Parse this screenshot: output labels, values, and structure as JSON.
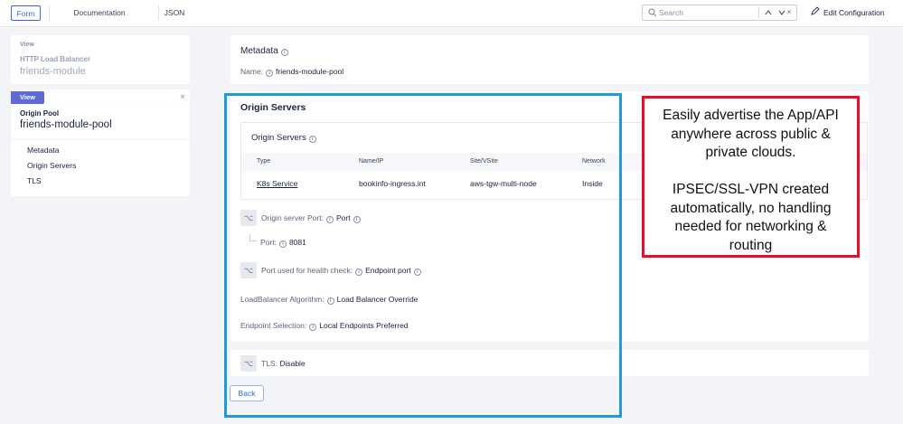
{
  "topbar": {
    "tabs": [
      "Form",
      "Documentation",
      "JSON"
    ],
    "active_tab": "Form",
    "search_placeholder": "Search",
    "search_prev": "^",
    "search_next": "v",
    "search_clear": "×",
    "edit_label": "Edit Configuration"
  },
  "sidebar": {
    "parent": {
      "view_label": "View",
      "type": "HTTP Load Balancer",
      "name": "friends-module"
    },
    "current": {
      "view_label": "View",
      "type": "Origin Pool",
      "name": "friends-module-pool",
      "close": "×"
    },
    "sections": [
      "Metadata",
      "Origin Servers",
      "TLS"
    ]
  },
  "metadata": {
    "title": "Metadata",
    "name_label": "Name:",
    "name_value": "friends-module-pool"
  },
  "origin": {
    "title": "Origin Servers",
    "table_title": "Origin Servers",
    "columns": [
      "Type",
      "Name/IP",
      "Site/VSite",
      "Network"
    ],
    "rows": [
      {
        "type": "K8s Service",
        "name": "bookinfo-ingress.int",
        "site": "aws-tgw-multi-node",
        "network": "Inside"
      }
    ],
    "origin_port_label": "Origin server Port:",
    "origin_port_value": "Port",
    "port_label": "Port:",
    "port_value": "8081",
    "health_label": "Port used for health check:",
    "health_value": "Endpoint port",
    "lb_label": "LoadBalancer Algorithm:",
    "lb_value": "Load Balancer Override",
    "endpoint_label": "Endpoint Selection:",
    "endpoint_value": "Local Endpoints Preferred"
  },
  "tls": {
    "label": "TLS:",
    "value": "Disable"
  },
  "back_label": "Back",
  "annotation": {
    "line1": "Easily advertise the App/API",
    "line2": "anywhere across public &",
    "line3": "private clouds.",
    "line4": "IPSEC/SSL-VPN created",
    "line5": "automatically, no handling",
    "line6": "needed for networking &",
    "line7": "routing"
  },
  "colors": {
    "accent": "#3d63d9",
    "badge": "#5d6ad8",
    "blue_outline": "#1e9bd9",
    "red_outline": "#e0112b"
  },
  "icons": {
    "search": "search-icon",
    "edit": "pencil-icon",
    "info": "info-icon",
    "field": "route-icon"
  }
}
